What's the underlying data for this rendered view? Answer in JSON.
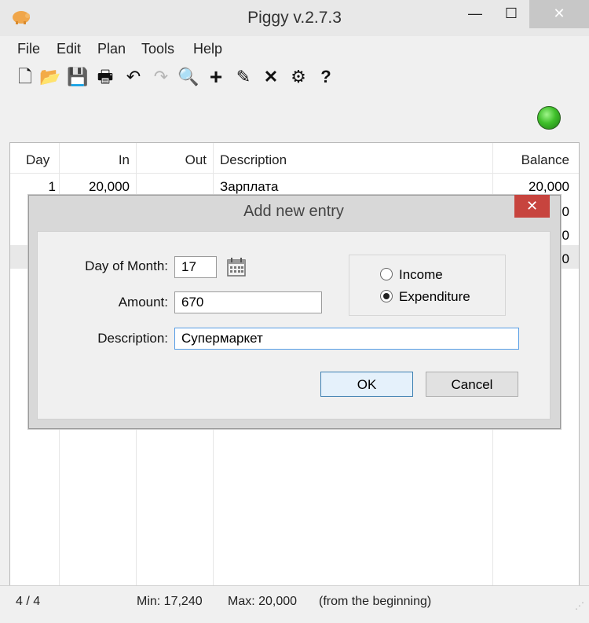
{
  "window": {
    "title": "Piggy v.2.7.3",
    "minimize_glyph": "—",
    "maximize_glyph": "☐",
    "close_glyph": "✕"
  },
  "menu": [
    "File",
    "Edit",
    "Plan",
    "Tools",
    "Help"
  ],
  "toolbar": {
    "icons": [
      "new-icon",
      "open-icon",
      "save-icon",
      "print-icon",
      "undo-icon",
      "redo-icon",
      "search-icon",
      "add-icon",
      "edit-icon",
      "delete-icon",
      "settings-icon",
      "help-icon"
    ],
    "glyphs": [
      "🗋",
      "📂",
      "💾",
      "🖶",
      "↶",
      "↷",
      "🔍",
      "+",
      "✎",
      "✕",
      "⚙",
      "?"
    ],
    "status_color": "#3fbf2a"
  },
  "table": {
    "headers": {
      "day": "Day",
      "in": "In",
      "out": "Out",
      "description": "Description",
      "balance": "Balance"
    },
    "rows": [
      {
        "day": "1",
        "in": "20,000",
        "out": "",
        "description": "Зарплата",
        "balance": "20,000"
      },
      {
        "balance_tail": "0"
      },
      {
        "balance_tail": "0"
      },
      {
        "balance_tail": "0"
      }
    ]
  },
  "status": {
    "count": "4 / 4",
    "min": "Min: 17,240",
    "max": "Max: 20,000",
    "range": "(from the beginning)"
  },
  "dialog": {
    "title": "Add new entry",
    "close_glyph": "✕",
    "day_label": "Day of Month:",
    "day_value": "17",
    "amount_label": "Amount:",
    "amount_value": "670",
    "description_label": "Description:",
    "description_value": "Супермаркет",
    "income_label": "Income",
    "expenditure_label": "Expenditure",
    "selected_type": "Expenditure",
    "ok_label": "OK",
    "cancel_label": "Cancel"
  }
}
